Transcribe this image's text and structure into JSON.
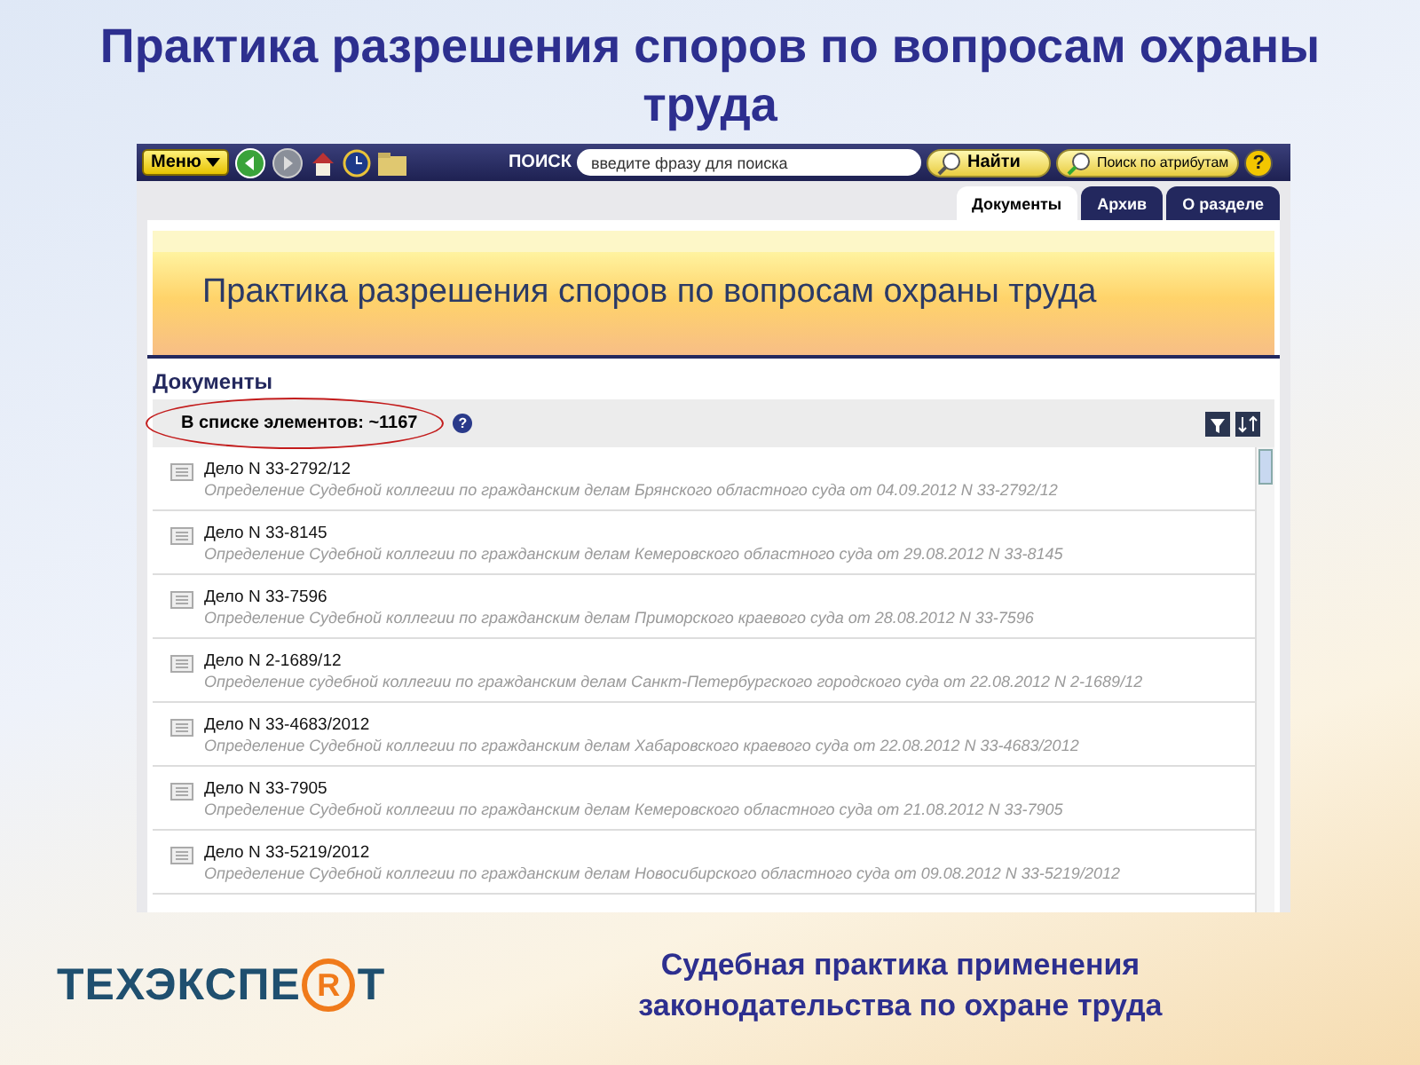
{
  "slide_title": "Практика разрешения споров по вопросам охраны труда",
  "toolbar": {
    "menu_button": "Меню",
    "search_label": "ПОИСК",
    "search": {
      "placeholder": "введите фразу для поиска"
    },
    "find_button": "Найти",
    "attribute_search_button": "Поиск по атрибутам",
    "help": "?"
  },
  "tabs": [
    {
      "label": "Документы",
      "selected": true
    },
    {
      "label": "Архив",
      "selected": false
    },
    {
      "label": "О разделе",
      "selected": false
    }
  ],
  "banner": "Практика разрешения споров по вопросам охраны труда",
  "section_title": "Документы",
  "list_count": "В списке элементов: ~1167",
  "count_help": "?",
  "documents": [
    {
      "title": "Дело N 33-2792/12",
      "description": "Определение Судебной коллегии по гражданским делам Брянского областного суда от 04.09.2012 N 33-2792/12"
    },
    {
      "title": "Дело N 33-8145",
      "description": "Определение Судебной коллегии по гражданским делам Кемеровского областного суда от 29.08.2012 N 33-8145"
    },
    {
      "title": "Дело N 33-7596",
      "description": "Определение Судебной коллегии по гражданским делам Приморского краевого суда от 28.08.2012 N 33-7596"
    },
    {
      "title": "Дело N 2-1689/12",
      "description": "Определение судебной коллегии по гражданским делам Санкт-Петербургского городского суда от 22.08.2012 N 2-1689/12"
    },
    {
      "title": "Дело N 33-4683/2012",
      "description": "Определение Судебной коллегии по гражданским делам Хабаровского краевого суда от 22.08.2012 N 33-4683/2012"
    },
    {
      "title": "Дело N 33-7905",
      "description": "Определение Судебной коллегии по гражданским делам Кемеровского областного суда от 21.08.2012 N 33-7905"
    },
    {
      "title": "Дело N 33-5219/2012",
      "description": "Определение Судебной коллегии по гражданским делам Новосибирского областного суда от 09.08.2012 N 33-5219/2012"
    }
  ],
  "logo": {
    "before": "ТЕХЭКСПЕ",
    "mark": "R",
    "after": "Т"
  },
  "caption": "Судебная практика применения законодательства по охране труда"
}
